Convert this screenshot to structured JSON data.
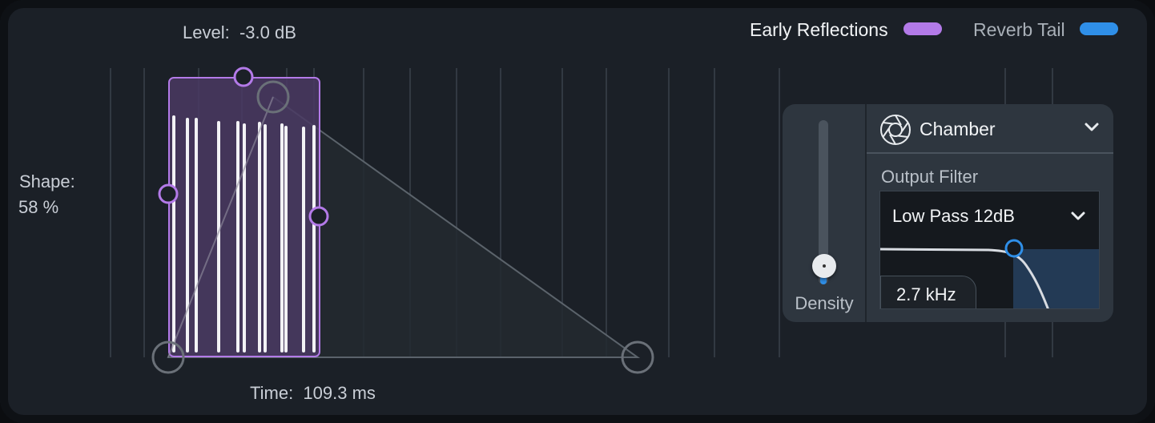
{
  "level": {
    "label": "Level:",
    "value": "-3.0 dB"
  },
  "shape": {
    "label": "Shape:",
    "value": "58 %"
  },
  "time": {
    "label": "Time:",
    "value": "109.3 ms"
  },
  "legend": [
    {
      "label": "Early Reflections",
      "color": "#b37ae8"
    },
    {
      "label": "Reverb Tail",
      "color": "#2f8fe8"
    }
  ],
  "density": {
    "label": "Density",
    "level": 0.1
  },
  "preset": {
    "name": "Chamber"
  },
  "output_filter": {
    "label": "Output Filter",
    "type": "Low Pass 12dB",
    "frequency": "2.7 kHz"
  },
  "colors": {
    "accent_purple": "#b37ae8",
    "accent_blue": "#2f8fe8",
    "background": "#1b2027"
  }
}
